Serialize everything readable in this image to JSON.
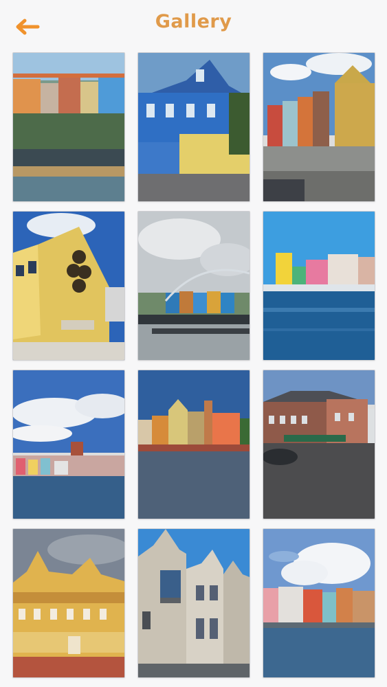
{
  "header": {
    "title": "Gallery",
    "back_icon": "arrow-left-icon",
    "accent_color": "#e09a4a",
    "back_color": "#f0922c"
  },
  "gallery": {
    "photos": [
      {
        "scene": "waterfront-market-colorful-buildings"
      },
      {
        "scene": "blue-colonial-building"
      },
      {
        "scene": "colorful-townhouses-street"
      },
      {
        "scene": "yellow-building-wall-ornament"
      },
      {
        "scene": "floating-bridge-cloudy-sky"
      },
      {
        "scene": "pastel-waterfront-harbor"
      },
      {
        "scene": "distant-waterfront-wide-sky"
      },
      {
        "scene": "harbor-gabled-houses"
      },
      {
        "scene": "brick-buildings-plaza"
      },
      {
        "scene": "yellow-gabled-colonial-building"
      },
      {
        "scene": "gabled-house-row-street"
      },
      {
        "scene": "waterfront-big-cloud"
      }
    ]
  }
}
